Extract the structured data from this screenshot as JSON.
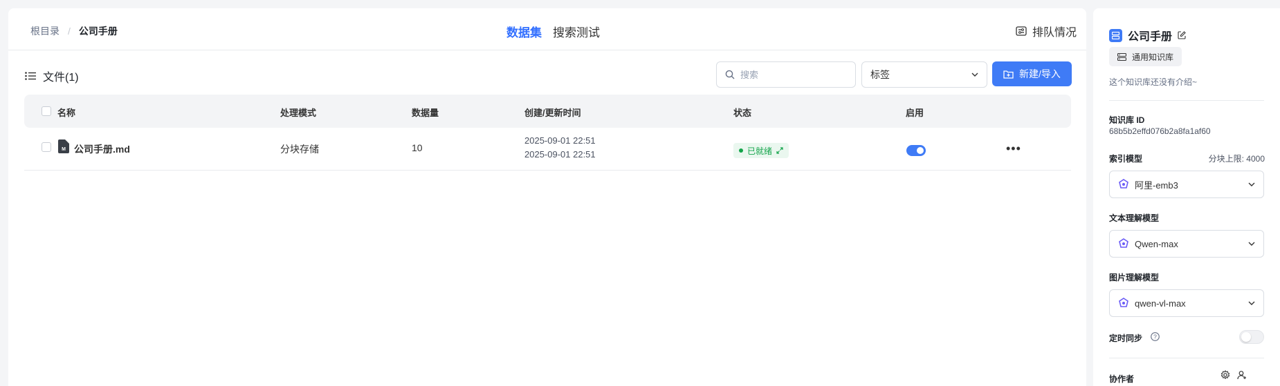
{
  "breadcrumb": {
    "root": "根目录",
    "separator": "/",
    "current": "公司手册"
  },
  "tabs": [
    {
      "label": "数据集",
      "active": true
    },
    {
      "label": "搜索测试",
      "active": false
    }
  ],
  "queue_label": "排队情况",
  "files": {
    "header": "文件(1)"
  },
  "search": {
    "placeholder": "搜索"
  },
  "tag_select": {
    "value": "标签"
  },
  "new_button": {
    "label": "新建/导入"
  },
  "table": {
    "columns": [
      "名称",
      "处理模式",
      "数据量",
      "创建/更新时间",
      "状态",
      "启用"
    ],
    "rows": [
      {
        "name": "公司手册.md",
        "mode": "分块存储",
        "count": "10",
        "created": "2025-09-01 22:51",
        "updated": "2025-09-01 22:51",
        "status": "已就绪",
        "enabled": true
      }
    ]
  },
  "sidebar": {
    "title": "公司手册",
    "kb_type": "通用知识库",
    "intro": "这个知识库还没有介绍~",
    "kb_id_label": "知识库 ID",
    "kb_id": "68b5b2effd076b2a8fa1af60",
    "index_model_label": "索引模型",
    "chunk_limit": "分块上限: 4000",
    "index_model": "阿里-emb3",
    "text_model_label": "文本理解模型",
    "text_model": "Qwen-max",
    "image_model_label": "图片理解模型",
    "image_model": "qwen-vl-max",
    "sync_label": "定时同步",
    "sync_enabled": false,
    "collaborators_label": "协作者"
  },
  "colors": {
    "accent": "#3f7bf6",
    "status_green": "#13a44a"
  }
}
